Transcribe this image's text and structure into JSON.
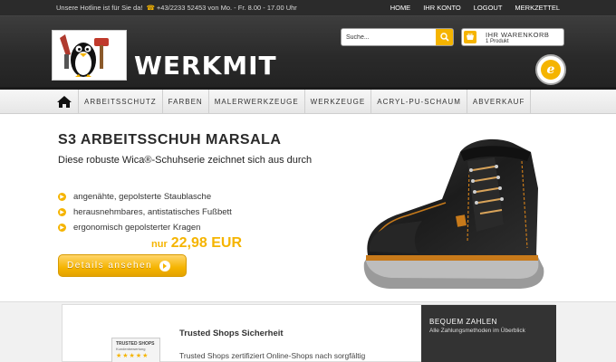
{
  "topbar": {
    "hotline_prefix": "Unsere Hotline ist für Sie da!",
    "phone_icon": "phone-icon",
    "hotline_details": "+43/2233 52453 von Mo. - Fr. 8.00 - 17.00 Uhr",
    "links": [
      "HOME",
      "IHR KONTO",
      "LOGOUT",
      "MERKZETTEL"
    ]
  },
  "header": {
    "logo_text": "WERKMIT",
    "search": {
      "placeholder": "Suche...",
      "button_icon": "search-icon"
    },
    "cart": {
      "title": "IHR WARENKORB",
      "count": "1 Produkt",
      "icon": "cart-icon"
    },
    "badge_icon": "trusted-shops-badge-icon"
  },
  "nav": {
    "home_icon": "home-icon",
    "items": [
      "ARBEITSSCHUTZ",
      "FARBEN",
      "MALERWERKZEUGE",
      "WERKZEUGE",
      "ACRYL-PU-SCHAUM",
      "ABVERKAUF"
    ]
  },
  "hero": {
    "title": "S3 ARBEITSSCHUH MARSALA",
    "subtitle": "Diese robuste Wica®-Schuhserie zeichnet sich aus durch",
    "features": [
      "angenähte, gepolsterte Staublasche",
      "herausnehmbares, antistatisches Fußbett",
      "ergonomisch gepolsterter Kragen"
    ],
    "price_prefix": "nur",
    "price": "22,98 EUR",
    "button_label": "Details ansehen",
    "accent_color": "#f5b400"
  },
  "trusted": {
    "heading": "Trusted Shops Sicherheit",
    "text": "Trusted Shops zertifiziert Online-Shops nach sorgfältig",
    "seal_title": "TRUSTED SHOPS",
    "seal_subtitle": "Kundenbewertung",
    "seal_stars": "★★★★★"
  },
  "payment": {
    "title": "BEQUEM ZAHLEN",
    "subtitle": "Alle Zahlungsmethoden im Überblick"
  }
}
